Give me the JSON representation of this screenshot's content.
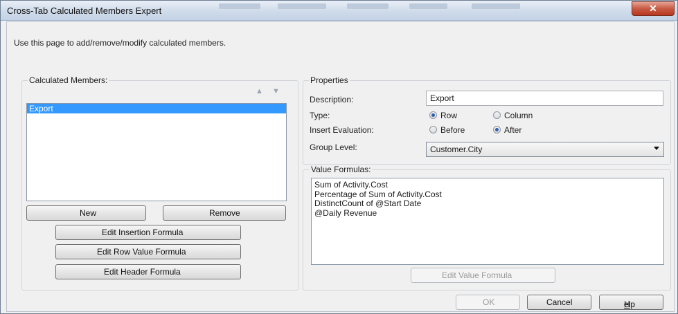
{
  "window": {
    "title": "Cross-Tab Calculated Members Expert",
    "close_glyph": "✕"
  },
  "intro_text": "Use this page to add/remove/modify calculated members.",
  "calculated_members": {
    "label": "Calculated Members:",
    "items": [
      {
        "label": "Export",
        "selected": true
      }
    ],
    "up_icon": "arrow-up-icon",
    "down_icon": "arrow-down-icon",
    "new_label": "New",
    "remove_label": "Remove",
    "edit_insertion_label": "Edit Insertion Formula",
    "edit_row_value_label": "Edit Row Value Formula",
    "edit_header_label": "Edit Header Formula"
  },
  "properties": {
    "label": "Properties",
    "description_label": "Description:",
    "description_value": "Export",
    "type_label": "Type:",
    "type_options": [
      {
        "label": "Row",
        "checked": true
      },
      {
        "label": "Column",
        "checked": false
      }
    ],
    "insert_label": "Insert Evaluation:",
    "insert_options": [
      {
        "label": "Before",
        "checked": false
      },
      {
        "label": "After",
        "checked": true
      }
    ],
    "group_level_label": "Group Level:",
    "group_level_value": "Customer.City"
  },
  "value_formulas": {
    "label": "Value Formulas:",
    "items": [
      "Sum of Activity.Cost",
      "Percentage of Sum of Activity.Cost",
      "DistinctCount of @Start Date",
      "@Daily Revenue"
    ],
    "edit_label": "Edit Value Formula"
  },
  "footer": {
    "ok_label": "OK",
    "cancel_label": "Cancel",
    "help_label_u": "H",
    "help_label_rest": "elp"
  },
  "colors": {
    "selection": "#3399ff",
    "window_bg": "#f0f0f0",
    "close_button": "#c75a44"
  }
}
